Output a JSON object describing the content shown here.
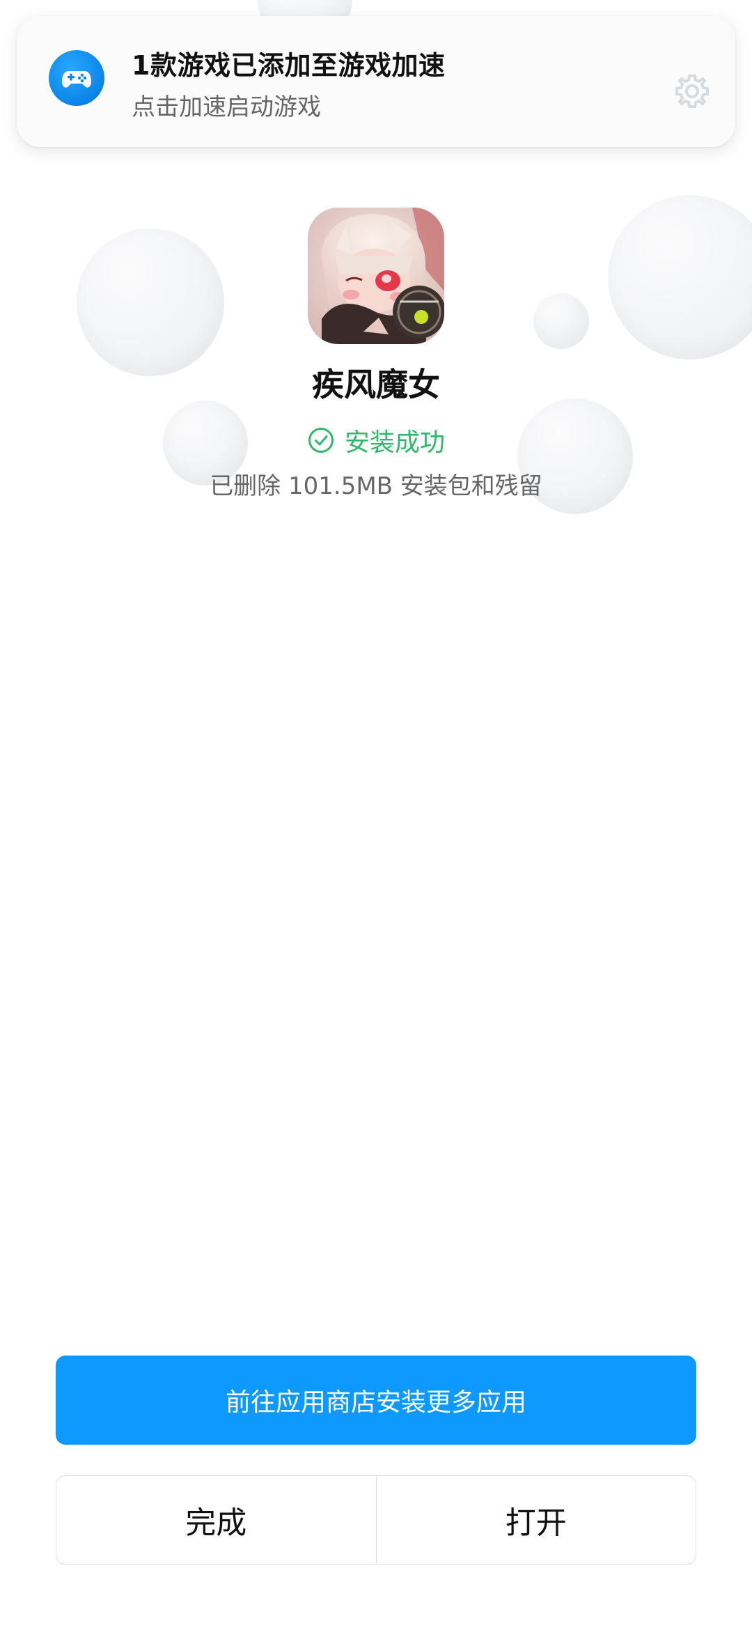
{
  "notification": {
    "title": "1款游戏已添加至游戏加速",
    "subtitle": "点击加速启动游戏",
    "icon": "gamepad-icon",
    "settings_icon": "gear-icon",
    "icon_color": "#0a84e8"
  },
  "app": {
    "name": "疾风魔女",
    "icon": "game-app-icon",
    "status": "安装成功",
    "status_color": "#2fb86c",
    "cleanup_message": "已删除 101.5MB 安装包和残留"
  },
  "buttons": {
    "store_label": "前往应用商店安装更多应用",
    "store_color": "#0d99ff",
    "done_label": "完成",
    "open_label": "打开"
  }
}
